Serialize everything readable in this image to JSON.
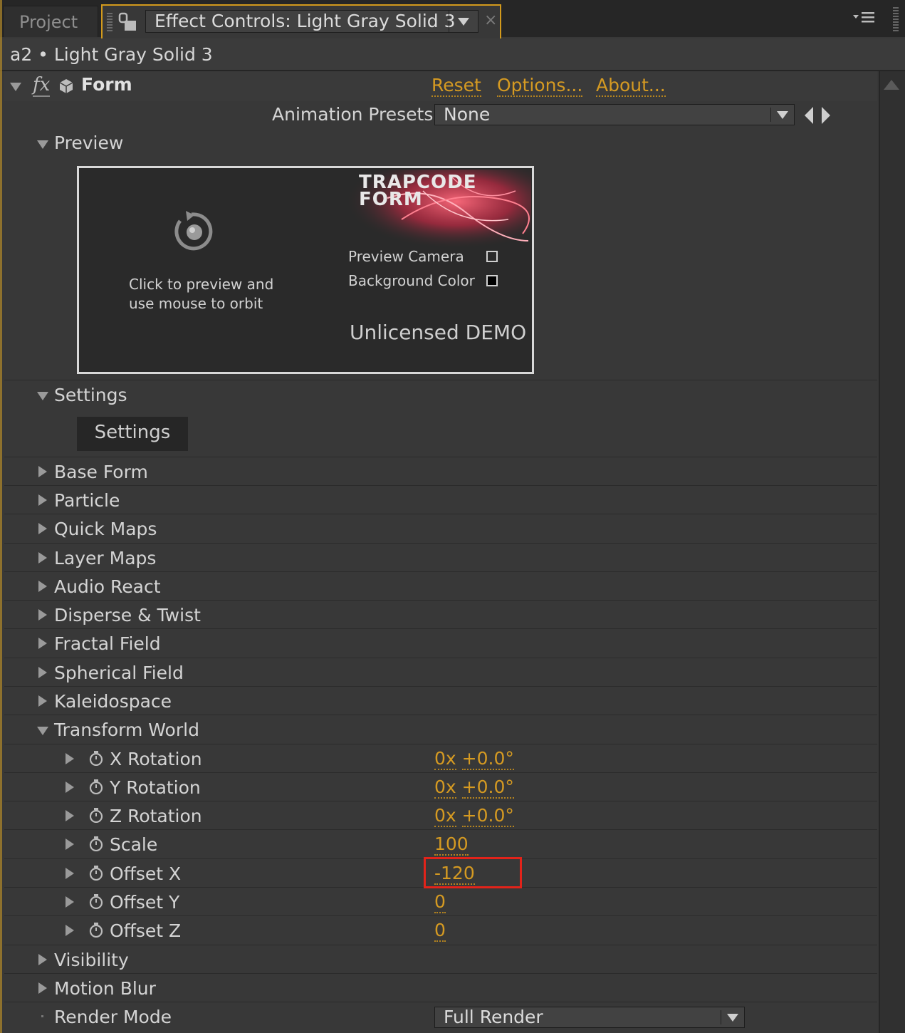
{
  "tabs": {
    "project_label": "Project",
    "effect_label": "Effect Controls: Light Gray Solid 3",
    "close_glyph": "×"
  },
  "breadcrumb": "a2 • Light Gray Solid 3",
  "effect": {
    "name": "Form",
    "fx_glyph": "fx",
    "reset_label": "Reset",
    "options_label": "Options...",
    "about_label": "About...",
    "animation_presets_label": "Animation Presets:",
    "animation_presets_value": "None"
  },
  "preview": {
    "section_label": "Preview",
    "instruction_line1": "Click to preview and",
    "instruction_line2": "use mouse to orbit",
    "logo_line1": "TRAPCODE",
    "logo_line2": "FORM",
    "preview_camera_label": "Preview Camera",
    "background_color_label": "Background Color",
    "license_text": "Unlicensed DEMO"
  },
  "settings": {
    "section_label": "Settings",
    "button_label": "Settings"
  },
  "groups": [
    {
      "label": "Base Form"
    },
    {
      "label": "Particle"
    },
    {
      "label": "Quick Maps"
    },
    {
      "label": "Layer Maps"
    },
    {
      "label": "Audio React"
    },
    {
      "label": "Disperse & Twist"
    },
    {
      "label": "Fractal Field"
    },
    {
      "label": "Spherical Field"
    },
    {
      "label": "Kaleidospace"
    }
  ],
  "transform_world": {
    "label": "Transform World",
    "params": [
      {
        "label": "X Rotation",
        "turns": "0x",
        "angle": "+0.0°"
      },
      {
        "label": "Y Rotation",
        "turns": "0x",
        "angle": "+0.0°"
      },
      {
        "label": "Z Rotation",
        "turns": "0x",
        "angle": "+0.0°"
      },
      {
        "label": "Scale",
        "value": "100"
      },
      {
        "label": "Offset X",
        "value": "-120"
      },
      {
        "label": "Offset Y",
        "value": "0"
      },
      {
        "label": "Offset Z",
        "value": "0"
      }
    ]
  },
  "tail_groups": [
    {
      "label": "Visibility"
    },
    {
      "label": "Motion Blur"
    }
  ],
  "render_mode": {
    "label": "Render Mode",
    "value": "Full Render"
  },
  "colors": {
    "accent_gold": "#d59a22",
    "highlight_red": "#e2231a",
    "panel_bg": "#383838"
  }
}
